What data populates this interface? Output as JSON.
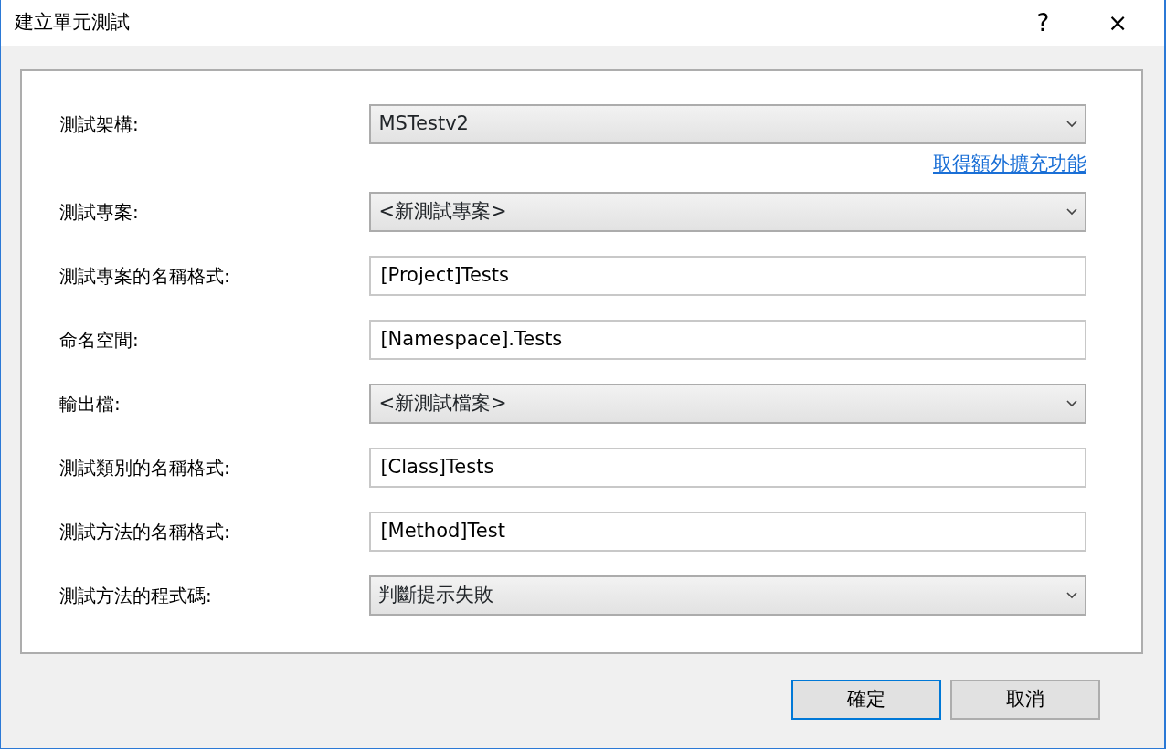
{
  "window": {
    "title": "建立單元測試",
    "help": "?",
    "close": "×"
  },
  "fields": [
    {
      "label": "測試架構:",
      "kind": "dropdown",
      "value": "MSTestv2",
      "link": "取得額外擴充功能"
    },
    {
      "label": "測試專案:",
      "kind": "dropdown",
      "value": "<新測試專案>"
    },
    {
      "label": "測試專案的名稱格式:",
      "kind": "text",
      "value": "[Project]Tests"
    },
    {
      "label": "命名空間:",
      "kind": "text",
      "value": "[Namespace].Tests"
    },
    {
      "label": "輸出檔:",
      "kind": "dropdown",
      "value": "<新測試檔案>"
    },
    {
      "label": "測試類別的名稱格式:",
      "kind": "text",
      "value": "[Class]Tests"
    },
    {
      "label": "測試方法的名稱格式:",
      "kind": "text",
      "value": "[Method]Test"
    },
    {
      "label": "測試方法的程式碼:",
      "kind": "dropdown",
      "value": "判斷提示失敗"
    }
  ],
  "buttons": [
    {
      "label": "確定",
      "default": true
    },
    {
      "label": "取消",
      "default": false
    }
  ]
}
